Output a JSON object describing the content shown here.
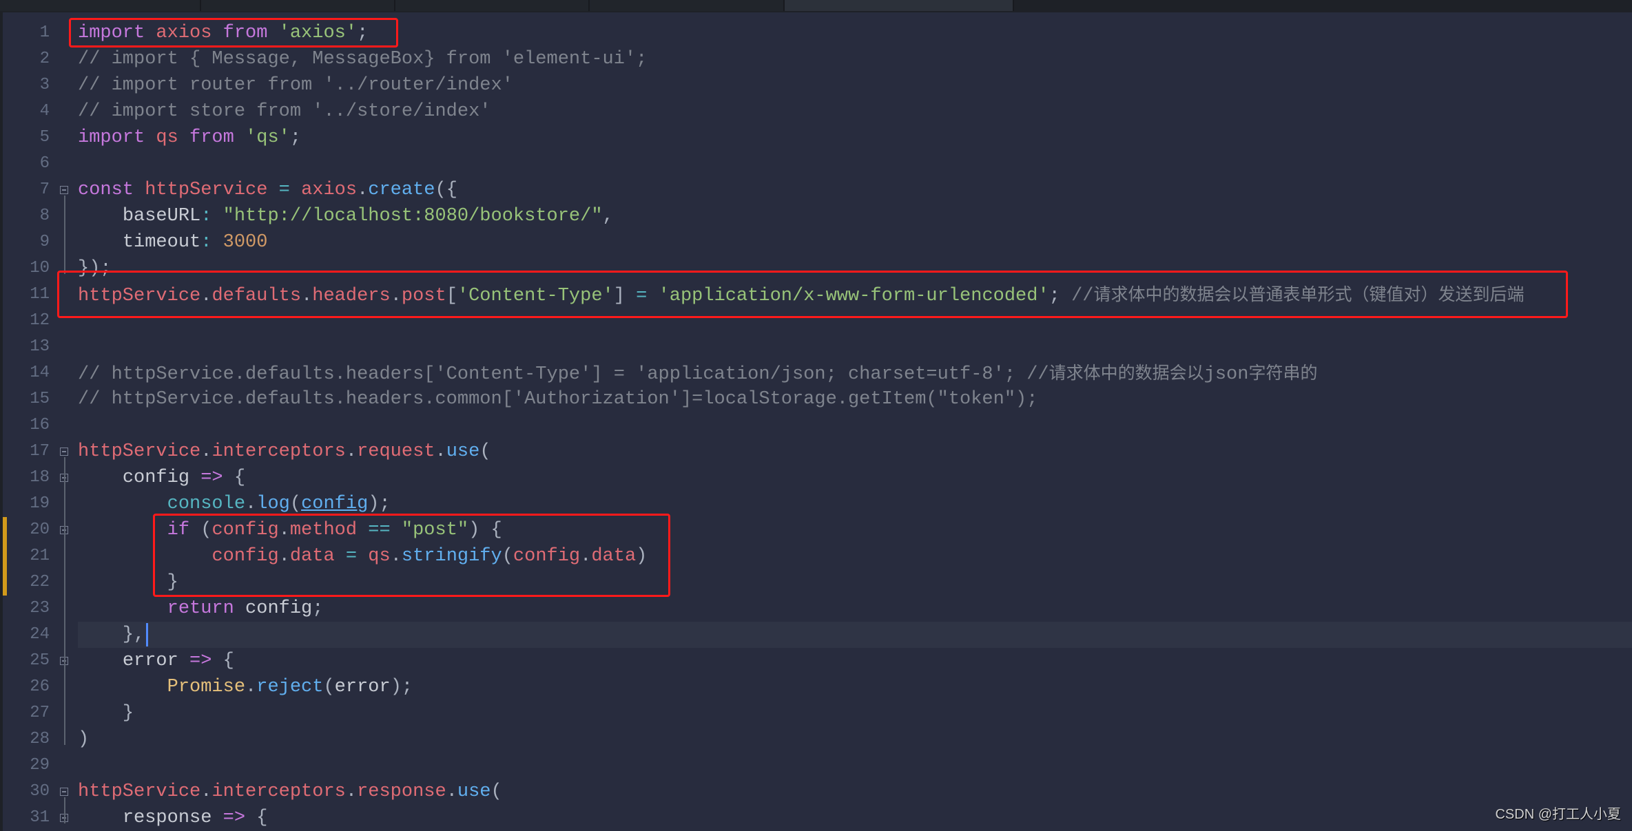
{
  "tabs": [
    {
      "label": ""
    },
    {
      "label": ""
    },
    {
      "label": ""
    },
    {
      "label": ""
    },
    {
      "label": "",
      "active": true
    }
  ],
  "colors": {
    "background": "#282c3e",
    "keyword": "#c678dd",
    "variable": "#e06c75",
    "string": "#98c379",
    "function": "#61afef",
    "comment": "#7f848e",
    "number": "#d19a66",
    "highlight_box": "#ff1a1a",
    "modified_marker": "#d29a1b"
  },
  "editor": {
    "current_line": 24,
    "folded_lines": [
      7,
      17,
      18,
      20,
      25,
      30,
      31
    ],
    "modified_lines": [
      20,
      21,
      22
    ],
    "highlighted_lines": [
      [
        1,
        1
      ],
      [
        11,
        11
      ],
      [
        20,
        22
      ]
    ],
    "lines": [
      [
        [
          "import",
          "k"
        ],
        [
          " "
        ],
        [
          "axios",
          "v"
        ],
        [
          " "
        ],
        [
          "from",
          "k"
        ],
        [
          " "
        ],
        [
          "'axios'",
          "s"
        ],
        [
          ";",
          "p"
        ]
      ],
      [
        [
          "// import { Message, MessageBox} from 'element-ui';",
          "c"
        ]
      ],
      [
        [
          "// import router from '../router/index'",
          "c"
        ]
      ],
      [
        [
          "// import store from '../store/index'",
          "c"
        ]
      ],
      [
        [
          "import",
          "k"
        ],
        [
          " "
        ],
        [
          "qs",
          "v"
        ],
        [
          " "
        ],
        [
          "from",
          "k"
        ],
        [
          " "
        ],
        [
          "'qs'",
          "s"
        ],
        [
          ";",
          "p"
        ]
      ],
      [],
      [
        [
          "const",
          "k"
        ],
        [
          " "
        ],
        [
          "httpService",
          "v"
        ],
        [
          " "
        ],
        [
          "=",
          "cy"
        ],
        [
          " "
        ],
        [
          "axios",
          "v"
        ],
        [
          ".",
          "p"
        ],
        [
          "create",
          "f"
        ],
        [
          "({",
          "p"
        ]
      ],
      [
        [
          "    "
        ],
        [
          "baseURL",
          "w"
        ],
        [
          ":",
          "cy"
        ],
        [
          " "
        ],
        [
          "\"http://localhost:8080/bookstore/\"",
          "s"
        ],
        [
          ",",
          "p"
        ]
      ],
      [
        [
          "    "
        ],
        [
          "timeout",
          "w"
        ],
        [
          ":",
          "cy"
        ],
        [
          " "
        ],
        [
          "3000",
          "n"
        ]
      ],
      [
        [
          "});",
          "p"
        ]
      ],
      [
        [
          "httpService",
          "v"
        ],
        [
          ".",
          "p"
        ],
        [
          "defaults",
          "v"
        ],
        [
          ".",
          "p"
        ],
        [
          "headers",
          "v"
        ],
        [
          ".",
          "p"
        ],
        [
          "post",
          "v"
        ],
        [
          "[",
          "p"
        ],
        [
          "'Content-Type'",
          "s"
        ],
        [
          "]",
          "p"
        ],
        [
          " "
        ],
        [
          "=",
          "cy"
        ],
        [
          " "
        ],
        [
          "'application/x-www-form-urlencoded'",
          "s"
        ],
        [
          ";",
          "p"
        ],
        [
          " "
        ],
        [
          "//",
          "c"
        ],
        [
          "请求体中的数据会以普通表单形式（键值对）发送到后端",
          "c cjk"
        ]
      ],
      [],
      [],
      [
        [
          "// httpService.defaults.headers['Content-Type'] = 'application/json; charset=utf-8'; //",
          "c"
        ],
        [
          "请求体中的数据会以",
          "c cjk"
        ],
        [
          "json",
          "c"
        ],
        [
          "字符串的",
          "c cjk"
        ]
      ],
      [
        [
          "// httpService.defaults.headers.common['Authorization']=localStorage.getItem(\"token\");",
          "c"
        ]
      ],
      [],
      [
        [
          "httpService",
          "v"
        ],
        [
          ".",
          "p"
        ],
        [
          "interceptors",
          "v"
        ],
        [
          ".",
          "p"
        ],
        [
          "request",
          "v"
        ],
        [
          ".",
          "p"
        ],
        [
          "use",
          "f"
        ],
        [
          "(",
          "p"
        ]
      ],
      [
        [
          "    "
        ],
        [
          "config",
          "w"
        ],
        [
          " "
        ],
        [
          "=>",
          "k"
        ],
        [
          " "
        ],
        [
          "{",
          "p"
        ]
      ],
      [
        [
          "        "
        ],
        [
          "console",
          "cy"
        ],
        [
          ".",
          "p"
        ],
        [
          "log",
          "f"
        ],
        [
          "(",
          "p"
        ],
        [
          "config",
          "u"
        ],
        [
          ");",
          "p"
        ]
      ],
      [
        [
          "        "
        ],
        [
          "if",
          "k"
        ],
        [
          " "
        ],
        [
          "(",
          "p"
        ],
        [
          "config",
          "v"
        ],
        [
          ".",
          "p"
        ],
        [
          "method",
          "v"
        ],
        [
          " "
        ],
        [
          "==",
          "cy"
        ],
        [
          " "
        ],
        [
          "\"post\"",
          "s"
        ],
        [
          ")",
          "p"
        ],
        [
          " "
        ],
        [
          "{",
          "p"
        ]
      ],
      [
        [
          "            "
        ],
        [
          "config",
          "v"
        ],
        [
          ".",
          "p"
        ],
        [
          "data",
          "v"
        ],
        [
          " "
        ],
        [
          "=",
          "cy"
        ],
        [
          " "
        ],
        [
          "qs",
          "v"
        ],
        [
          ".",
          "p"
        ],
        [
          "stringify",
          "f"
        ],
        [
          "(",
          "p"
        ],
        [
          "config",
          "v"
        ],
        [
          ".",
          "p"
        ],
        [
          "data",
          "v"
        ],
        [
          ")",
          "p"
        ]
      ],
      [
        [
          "        "
        ],
        [
          "}",
          "p"
        ]
      ],
      [
        [
          "        "
        ],
        [
          "return",
          "k"
        ],
        [
          " "
        ],
        [
          "config",
          "w"
        ],
        [
          ";",
          "p"
        ]
      ],
      [
        [
          "    "
        ],
        [
          "},",
          "p"
        ]
      ],
      [
        [
          "    "
        ],
        [
          "error",
          "w"
        ],
        [
          " "
        ],
        [
          "=>",
          "k"
        ],
        [
          " "
        ],
        [
          "{",
          "p"
        ]
      ],
      [
        [
          "        "
        ],
        [
          "Promise",
          "y"
        ],
        [
          ".",
          "p"
        ],
        [
          "reject",
          "f"
        ],
        [
          "(",
          "p"
        ],
        [
          "error",
          "w"
        ],
        [
          ");",
          "p"
        ]
      ],
      [
        [
          "    "
        ],
        [
          "}",
          "p"
        ]
      ],
      [
        [
          ")",
          "p"
        ]
      ],
      [],
      [
        [
          "httpService",
          "v"
        ],
        [
          ".",
          "p"
        ],
        [
          "interceptors",
          "v"
        ],
        [
          ".",
          "p"
        ],
        [
          "response",
          "v"
        ],
        [
          ".",
          "p"
        ],
        [
          "use",
          "f"
        ],
        [
          "(",
          "p"
        ]
      ],
      [
        [
          "    "
        ],
        [
          "response",
          "w"
        ],
        [
          " "
        ],
        [
          "=>",
          "k"
        ],
        [
          " "
        ],
        [
          "{",
          "p"
        ]
      ]
    ]
  },
  "watermark": "CSDN @打工人小夏"
}
